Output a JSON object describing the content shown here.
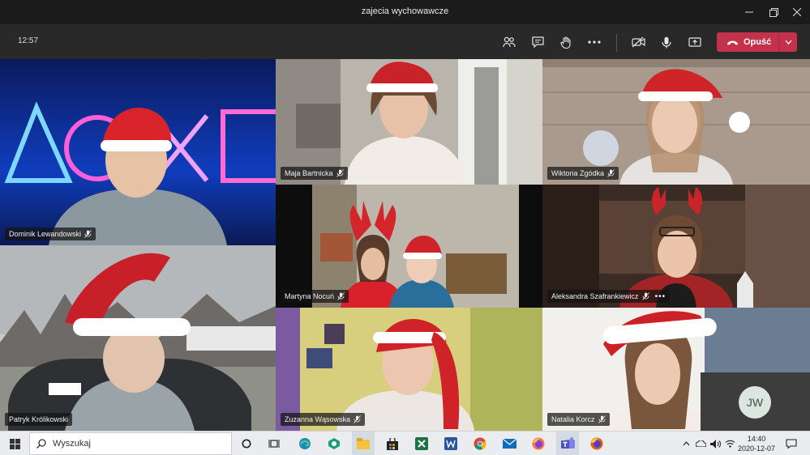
{
  "window": {
    "title": "zajecia wychowawcze",
    "controls": [
      "minimize",
      "maximize",
      "close"
    ]
  },
  "meeting": {
    "clock": "12:57",
    "toolbar_icons": [
      "participants-icon",
      "chat-icon",
      "raise-hand-icon",
      "more-icon",
      "camera-off-icon",
      "microphone-icon",
      "share-screen-icon"
    ],
    "leave_label": "Opuść",
    "accent": "#c4314b"
  },
  "participants": [
    {
      "name": "Dominik Lewandowski",
      "muted": true
    },
    {
      "name": "Maja Bartnicka",
      "muted": true
    },
    {
      "name": "Wiktoria Zgódka",
      "muted": true
    },
    {
      "name": "Martyna Nocuń",
      "muted": true
    },
    {
      "name": "Aleksandra Szafrankiewicz",
      "muted": true,
      "more": "•••"
    },
    {
      "name": "Patryk Królikowski",
      "muted": false
    },
    {
      "name": "Zuzanna Wąsowska",
      "muted": true
    },
    {
      "name": "Natalia Korcz",
      "muted": true
    }
  ],
  "self_avatar": {
    "initials": "JW"
  },
  "taskbar": {
    "search_placeholder": "Wyszukaj",
    "apps": [
      "cortana-icon",
      "task-view-icon",
      "edge-icon",
      "app-green-icon",
      "file-explorer-icon",
      "store-icon",
      "excel-icon",
      "word-icon",
      "chrome-icon",
      "mail-icon",
      "firefox-icon",
      "teams-icon",
      "firefox-alt-icon"
    ],
    "time": "14:40",
    "date": "2020-12-07"
  }
}
